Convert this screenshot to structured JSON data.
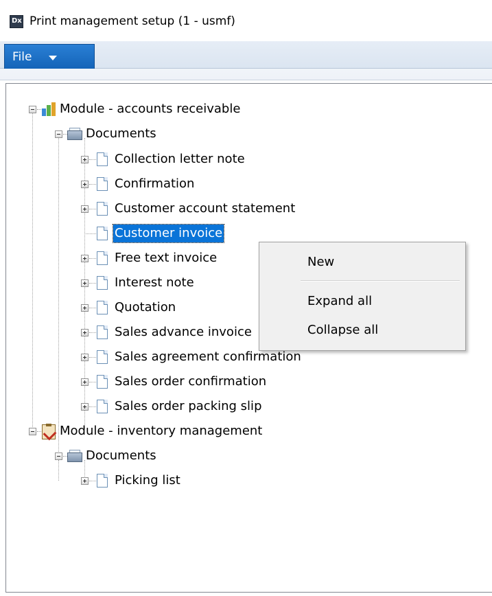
{
  "window": {
    "title": "Print management setup (1 - usmf)",
    "icon": "app-logo-icon"
  },
  "ribbon": {
    "file_label": "File"
  },
  "tree": {
    "modules": [
      {
        "label": "Module - accounts receivable",
        "icon": "module-chart-icon",
        "documents_label": "Documents",
        "documents": [
          {
            "label": "Collection letter note",
            "expandable": true
          },
          {
            "label": "Confirmation",
            "expandable": true
          },
          {
            "label": "Customer account statement",
            "expandable": true
          },
          {
            "label": "Customer invoice",
            "expandable": false,
            "selected": true
          },
          {
            "label": "Free text invoice",
            "expandable": true
          },
          {
            "label": "Interest note",
            "expandable": true
          },
          {
            "label": "Quotation",
            "expandable": true
          },
          {
            "label": "Sales advance invoice",
            "expandable": true
          },
          {
            "label": "Sales agreement confirmation",
            "expandable": true
          },
          {
            "label": "Sales order confirmation",
            "expandable": true
          },
          {
            "label": "Sales order packing slip",
            "expandable": true
          }
        ]
      },
      {
        "label": "Module - inventory management",
        "icon": "module-clipboard-icon",
        "documents_label": "Documents",
        "documents": [
          {
            "label": "Picking list",
            "expandable": true
          }
        ]
      }
    ]
  },
  "context_menu": {
    "items": [
      "New",
      "Expand all",
      "Collapse all"
    ]
  },
  "colors": {
    "selection": "#0a74d8",
    "file_tab": "#1a6fc7"
  }
}
